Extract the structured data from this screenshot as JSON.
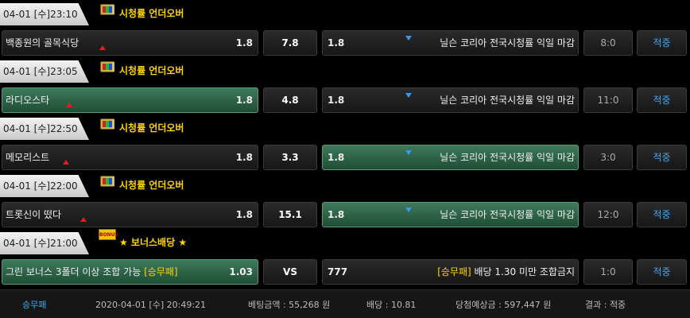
{
  "bets": [
    {
      "date": "04-01 [수]23:10",
      "header_title": "시청률 언더오버",
      "header_icon": "tv-icon",
      "home_name": "백종원의 골목식당",
      "home_odds": "1.8",
      "mid": "7.8",
      "away_odds": "1.8",
      "away_name": "닐슨 코리아 전국시청률 익일 마감",
      "score": "8:0",
      "result": "적중",
      "selected": "none"
    },
    {
      "date": "04-01 [수]23:05",
      "header_title": "시청률 언더오버",
      "header_icon": "tv-icon",
      "home_name": "라디오스타",
      "home_odds": "1.8",
      "mid": "4.8",
      "away_odds": "1.8",
      "away_name": "닐슨 코리아 전국시청률 익일 마감",
      "score": "11:0",
      "result": "적중",
      "selected": "home"
    },
    {
      "date": "04-01 [수]22:50",
      "header_title": "시청률 언더오버",
      "header_icon": "tv-icon",
      "home_name": "메모리스트",
      "home_odds": "1.8",
      "mid": "3.3",
      "away_odds": "1.8",
      "away_name": "닐슨 코리아 전국시청률 익일 마감",
      "score": "3:0",
      "result": "적중",
      "selected": "away"
    },
    {
      "date": "04-01 [수]22:00",
      "header_title": "시청률 언더오버",
      "header_icon": "tv-icon",
      "home_name": "트롯신이 떴다",
      "home_odds": "1.8",
      "mid": "15.1",
      "away_odds": "1.8",
      "away_name": "닐슨 코리아 전국시청률 익일 마감",
      "score": "12:0",
      "result": "적중",
      "selected": "away"
    },
    {
      "date": "04-01 [수]21:00",
      "header_title": "★ 보너스배당 ★",
      "header_icon": "bonus-icon",
      "header_icon_text": "BONUS",
      "home_name": "그린 보너스 3폴더 이상 조합 가능",
      "home_tag": "[승무패]",
      "home_odds": "1.03",
      "mid": "VS",
      "away_odds": "777",
      "away_tag": "[승무패]",
      "away_name": "배당 1.30 미만 조합금지",
      "score": "1:0",
      "result": "적중",
      "selected": "home"
    }
  ],
  "summary": {
    "type": "승무패",
    "datetime": "2020-04-01 [수] 20:49:21",
    "bet_amount": "베팅금액 : 55,268 원",
    "odds": "배당 : 10.81",
    "expected": "당첨예상금 : 597,447 원",
    "result": "결과 : 적중"
  },
  "colors": {
    "accent_yellow": "#ffd400",
    "result_blue": "#3fa9f5",
    "selected_green": "#2f6a4a",
    "up_arrow_red": "#e0201e",
    "down_arrow_blue": "#3399ff"
  }
}
